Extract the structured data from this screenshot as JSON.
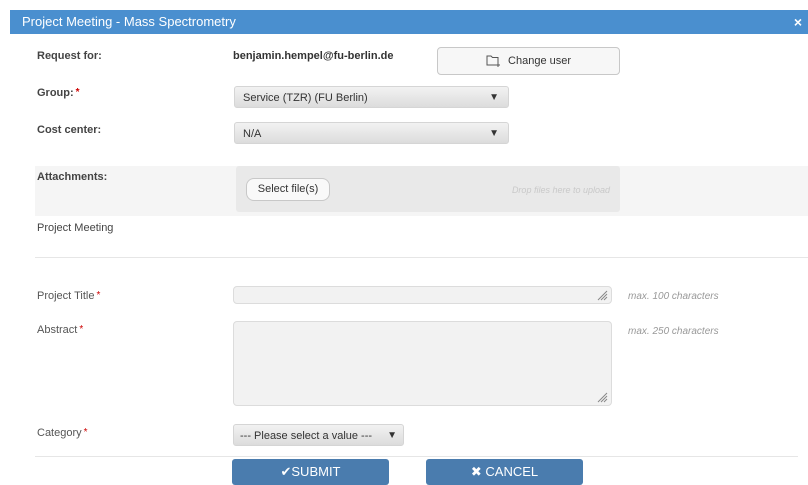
{
  "dialog": {
    "title": "Project Meeting - Mass Spectrometry",
    "close_icon": "×"
  },
  "request_for": {
    "label": "Request for:",
    "value": "benjamin.hempel@fu-berlin.de",
    "change_user_label": "Change user"
  },
  "group": {
    "label": "Group:",
    "value": "Service (TZR) (FU Berlin)"
  },
  "cost_center": {
    "label": "Cost center:",
    "value": "N/A"
  },
  "attachments": {
    "label": "Attachments:",
    "select_label": "Select file(s)",
    "drop_hint": "Drop files here to upload"
  },
  "section_title": "Project Meeting",
  "project_title": {
    "label": "Project Title",
    "hint": "max. 100 characters",
    "value": ""
  },
  "abstract": {
    "label": "Abstract",
    "hint": "max. 250 characters",
    "value": ""
  },
  "category": {
    "label": "Category",
    "value": "--- Please select a value ---"
  },
  "required_mark": "*",
  "actions": {
    "submit_label": "SUBMIT",
    "cancel_label": "CANCEL"
  },
  "colors": {
    "title_bar": "#4a8fcf",
    "primary_button": "#4a7cae",
    "required": "#cc0000"
  }
}
